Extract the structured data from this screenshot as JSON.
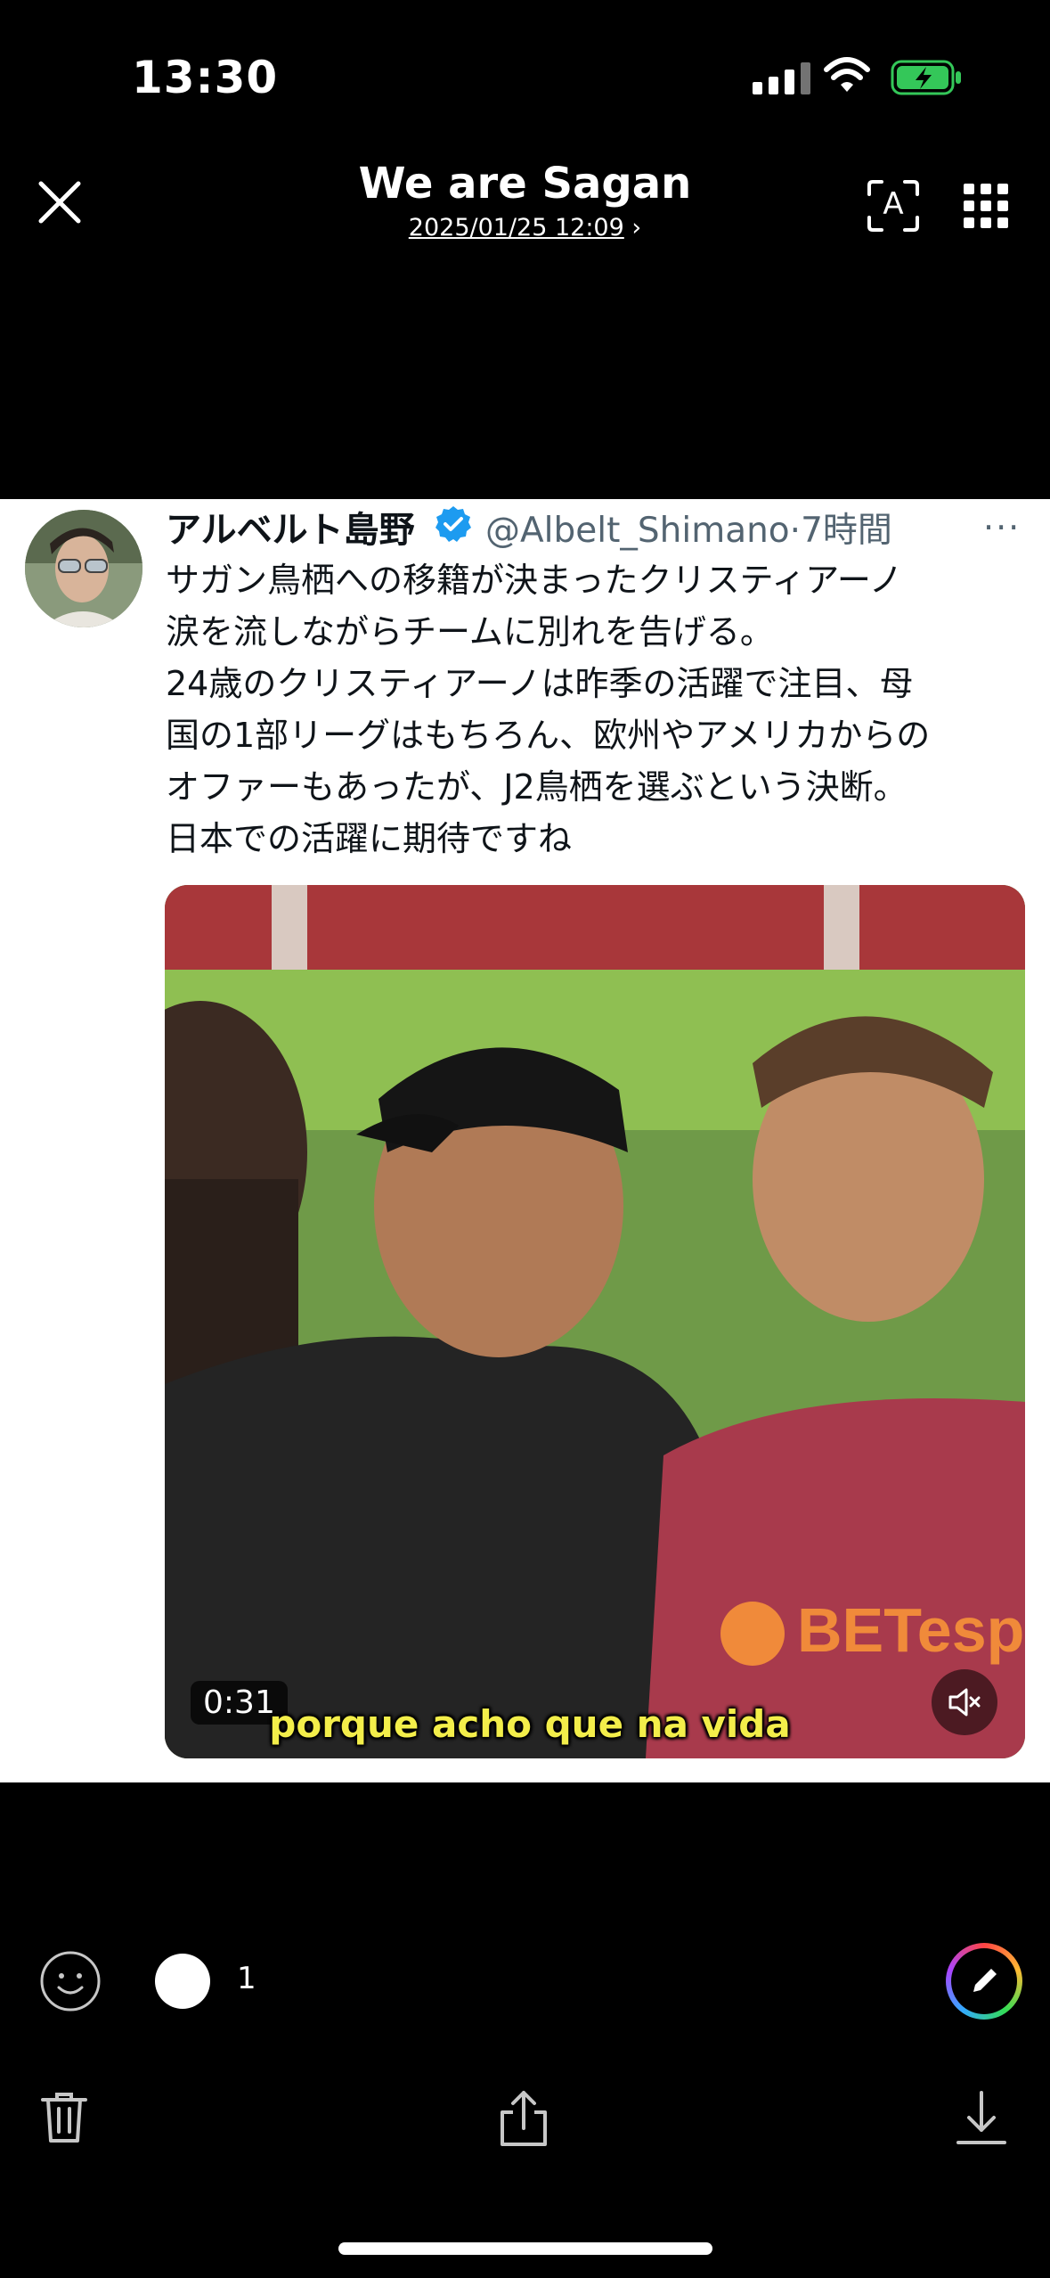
{
  "status_bar": {
    "time": "13:30",
    "icons": [
      "cellular-signal-icon",
      "wifi-icon",
      "battery-charging-icon"
    ]
  },
  "header": {
    "title": "We are Sagan",
    "datetime": "2025/01/25 12:09",
    "datetime_chevron": "›",
    "icons": [
      "close-icon",
      "live-text-icon",
      "grid-icon"
    ],
    "live_text_letter": "A"
  },
  "post": {
    "author_name": "アルベルト島野",
    "handle": "@Albelt_Shimano",
    "separator": "·",
    "time_ago": "7時間",
    "more": "···",
    "lines": [
      "サガン鳥栖への移籍が決まったクリスティアーノ",
      "涙を流しながらチームに別れを告げる。",
      "24歳のクリスティアーノは昨季の活躍で注目、母",
      "国の1部リーグはもちろん、欧州やアメリカからの",
      "オファーもあったが、J2鳥栖を選ぶという決断。",
      "日本での活躍に期待ですね"
    ],
    "video": {
      "duration": "0:31",
      "subtitle": "porque acho que na vida",
      "mute_icon": "speaker-muted-icon"
    }
  },
  "bottom_bar": {
    "reaction_emoji": "😍",
    "reaction_count": "1",
    "icons": [
      "smiley-add-icon",
      "markup-pen-icon",
      "trash-icon",
      "share-icon",
      "download-icon"
    ]
  },
  "colors": {
    "background": "#000000",
    "card": "#ffffff",
    "verified": "#1d9bf0",
    "battery_charge": "#34c759",
    "subtitle_yellow": "#f3ee4a"
  }
}
